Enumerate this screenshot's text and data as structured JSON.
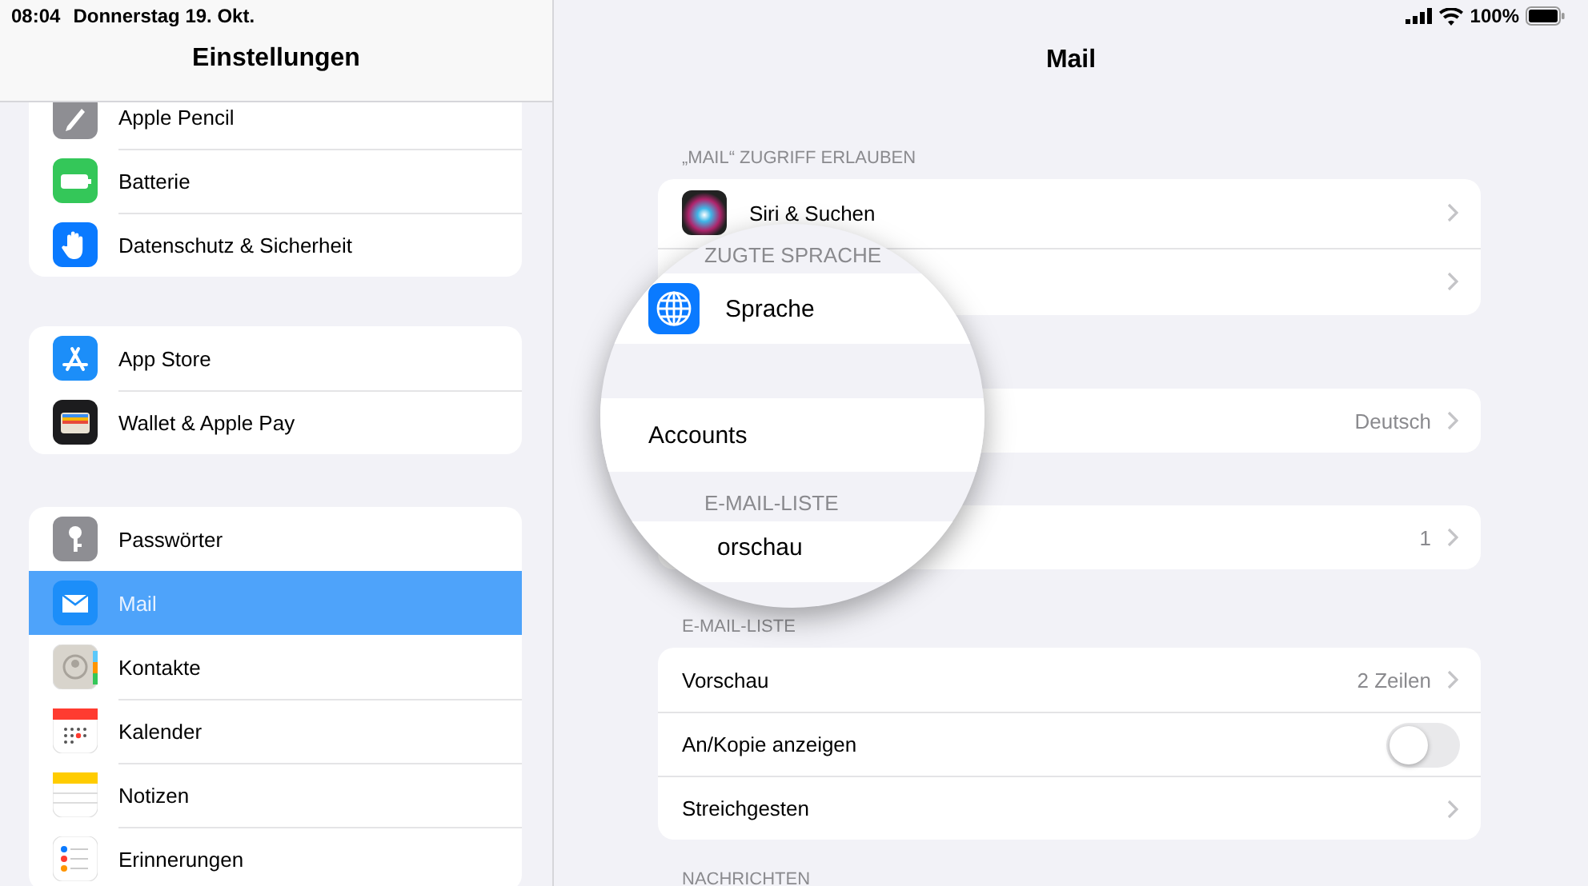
{
  "status_bar": {
    "time": "08:04",
    "date": "Donnerstag 19. Okt.",
    "battery": "100%"
  },
  "sidebar": {
    "title": "Einstellungen",
    "groups": [
      {
        "items": [
          {
            "label": "Apple Pencil",
            "selected": false
          },
          {
            "label": "Batterie",
            "selected": false
          },
          {
            "label": "Datenschutz & Sicherheit",
            "selected": false
          }
        ]
      },
      {
        "items": [
          {
            "label": "App Store",
            "selected": false
          },
          {
            "label": "Wallet & Apple Pay",
            "selected": false
          }
        ]
      },
      {
        "items": [
          {
            "label": "Passwörter",
            "selected": false
          },
          {
            "label": "Mail",
            "selected": true
          },
          {
            "label": "Kontakte",
            "selected": false
          },
          {
            "label": "Kalender",
            "selected": false
          },
          {
            "label": "Notizen",
            "selected": false
          },
          {
            "label": "Erinnerungen",
            "selected": false
          }
        ]
      }
    ]
  },
  "detail": {
    "title": "Mail",
    "sections": [
      {
        "header": "„MAIL“ ZUGRIFF ERLAUBEN",
        "rows": [
          {
            "kind": "link",
            "label": "Siri & Suchen"
          },
          {
            "kind": "link"
          }
        ]
      },
      {
        "rows": [
          {
            "kind": "link",
            "value": "Deutsch"
          }
        ]
      },
      {
        "rows": [
          {
            "kind": "link",
            "value": "1"
          }
        ]
      },
      {
        "header": "E-MAIL-LISTE",
        "rows": [
          {
            "kind": "link",
            "label": "Vorschau",
            "value": "2 Zeilen"
          },
          {
            "kind": "toggle",
            "label": "An/Kopie anzeigen",
            "on": false
          },
          {
            "kind": "link",
            "label": "Streichgesten"
          }
        ]
      },
      {
        "header": "NACHRICHTEN"
      }
    ]
  },
  "magnifier": {
    "sections": [
      {
        "header": "ZUGTE SPRACHE",
        "rows": [
          {
            "label": "Sprache"
          }
        ]
      },
      {
        "rows": [
          {
            "label": "Accounts"
          }
        ]
      },
      {
        "header": "E-MAIL-LISTE",
        "rows": [
          {
            "label": "orschau"
          }
        ]
      }
    ]
  }
}
